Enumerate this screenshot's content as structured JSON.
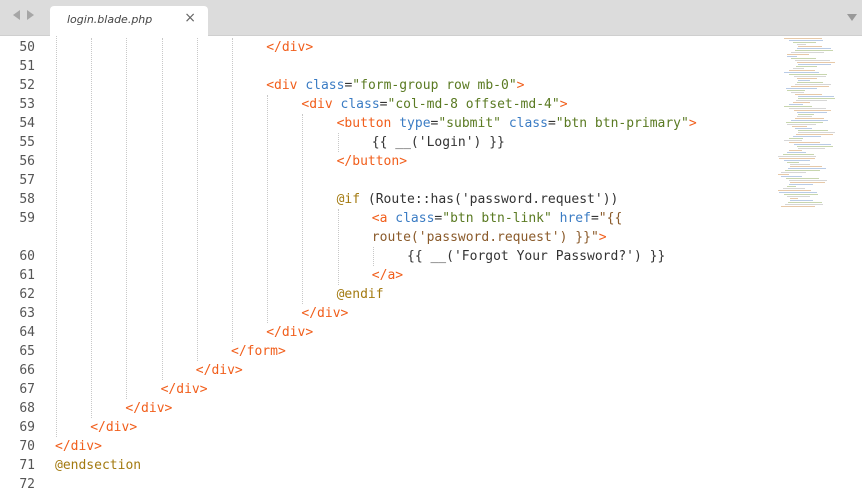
{
  "tab": {
    "title": "login.blade.php",
    "close_glyph": "×"
  },
  "colors": {
    "tag": "#f15e1b",
    "attr": "#3b7cc4",
    "string": "#5a7a22",
    "string_alt": "#8a5a2a",
    "blade": "#a37a10",
    "text": "#333333",
    "gutter_text": "#555555",
    "tab_bar": "#dcdcdc"
  },
  "lines": [
    {
      "n": "50",
      "row": 0,
      "indent": 6,
      "segs": [
        [
          "t",
          "</div>"
        ]
      ]
    },
    {
      "n": "51",
      "row": 1,
      "indent": 0,
      "segs": []
    },
    {
      "n": "52",
      "row": 2,
      "indent": 6,
      "segs": [
        [
          "t",
          "<div "
        ],
        [
          "a",
          "class"
        ],
        [
          "p",
          "="
        ],
        [
          "s",
          "\"form-group row mb-0\""
        ],
        [
          "t",
          ">"
        ]
      ]
    },
    {
      "n": "53",
      "row": 3,
      "indent": 7,
      "segs": [
        [
          "t",
          "<div "
        ],
        [
          "a",
          "class"
        ],
        [
          "p",
          "="
        ],
        [
          "s",
          "\"col-md-8 offset-md-4\""
        ],
        [
          "t",
          ">"
        ]
      ]
    },
    {
      "n": "54",
      "row": 4,
      "indent": 8,
      "segs": [
        [
          "t",
          "<button "
        ],
        [
          "a",
          "type"
        ],
        [
          "p",
          "="
        ],
        [
          "s",
          "\"submit\""
        ],
        [
          "p",
          " "
        ],
        [
          "a",
          "class"
        ],
        [
          "p",
          "="
        ],
        [
          "s",
          "\"btn btn-primary\""
        ],
        [
          "t",
          ">"
        ]
      ]
    },
    {
      "n": "55",
      "row": 5,
      "indent": 9,
      "segs": [
        [
          "p",
          "{{ __('Login') }}"
        ]
      ]
    },
    {
      "n": "56",
      "row": 6,
      "indent": 8,
      "segs": [
        [
          "t",
          "</button>"
        ]
      ]
    },
    {
      "n": "57",
      "row": 7,
      "indent": 0,
      "segs": []
    },
    {
      "n": "58",
      "row": 8,
      "indent": 8,
      "segs": [
        [
          "b",
          "@if"
        ],
        [
          "p",
          " (Route::has('password.request'))"
        ]
      ]
    },
    {
      "n": "59",
      "row": 9,
      "indent": 9,
      "segs": [
        [
          "t",
          "<a "
        ],
        [
          "a",
          "class"
        ],
        [
          "p",
          "="
        ],
        [
          "s",
          "\"btn btn-link\""
        ],
        [
          "p",
          " "
        ],
        [
          "a",
          "href"
        ],
        [
          "p",
          "="
        ],
        [
          "s2",
          "\"{{"
        ]
      ]
    },
    {
      "n": "",
      "row": 10,
      "indent": 9,
      "segs": [
        [
          "s2",
          "route('password.request') }}\""
        ],
        [
          "t",
          ">"
        ]
      ]
    },
    {
      "n": "60",
      "row": 11,
      "indent": 10,
      "segs": [
        [
          "p",
          "{{ __('Forgot Your Password?') }}"
        ]
      ]
    },
    {
      "n": "61",
      "row": 12,
      "indent": 9,
      "segs": [
        [
          "t",
          "</a>"
        ]
      ]
    },
    {
      "n": "62",
      "row": 13,
      "indent": 8,
      "segs": [
        [
          "b",
          "@endif"
        ]
      ]
    },
    {
      "n": "63",
      "row": 14,
      "indent": 7,
      "segs": [
        [
          "t",
          "</div>"
        ]
      ]
    },
    {
      "n": "64",
      "row": 15,
      "indent": 6,
      "segs": [
        [
          "t",
          "</div>"
        ]
      ]
    },
    {
      "n": "65",
      "row": 16,
      "indent": 5,
      "segs": [
        [
          "t",
          "</form>"
        ]
      ]
    },
    {
      "n": "66",
      "row": 17,
      "indent": 4,
      "segs": [
        [
          "t",
          "</div>"
        ]
      ]
    },
    {
      "n": "67",
      "row": 18,
      "indent": 3,
      "segs": [
        [
          "t",
          "</div>"
        ]
      ]
    },
    {
      "n": "68",
      "row": 19,
      "indent": 2,
      "segs": [
        [
          "t",
          "</div>"
        ]
      ]
    },
    {
      "n": "69",
      "row": 20,
      "indent": 1,
      "segs": [
        [
          "t",
          "</div>"
        ]
      ]
    },
    {
      "n": "70",
      "row": 21,
      "indent": 0,
      "segs": [
        [
          "t",
          "</div>"
        ]
      ]
    },
    {
      "n": "71",
      "row": 22,
      "indent": 0,
      "segs": [
        [
          "b",
          "@endsection"
        ]
      ]
    },
    {
      "n": "72",
      "row": 23,
      "indent": 0,
      "segs": []
    }
  ]
}
